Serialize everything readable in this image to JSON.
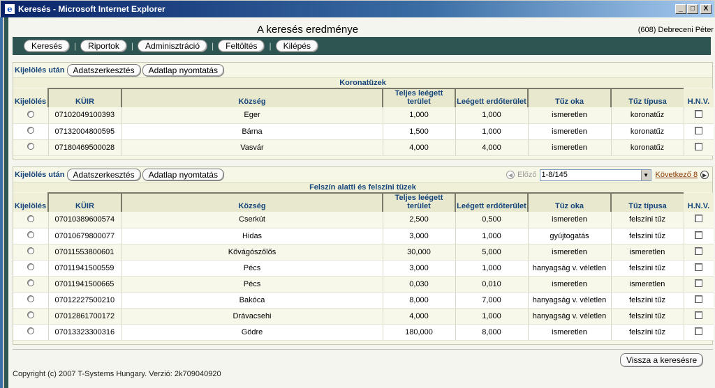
{
  "window": {
    "title": "Keresés - Microsoft Internet Explorer",
    "minimize": "_",
    "maximize": "□",
    "close": "X"
  },
  "page": {
    "title": "A keresés eredménye",
    "user": "(608) Debreceni Péter"
  },
  "nav": [
    {
      "label": "Keresés"
    },
    {
      "label": "Riportok"
    },
    {
      "label": "Adminisztráció"
    },
    {
      "label": "Feltöltés"
    },
    {
      "label": "Kilépés"
    }
  ],
  "nav_sep": "|",
  "toolbar": {
    "label": "Kijelölés után",
    "edit": "Adatszerkesztés",
    "print": "Adatlap nyomtatás"
  },
  "columns": {
    "sel": "Kijelölés",
    "kuir": "KÜIR",
    "kozseg": "Község",
    "terulet": "Teljes leégett terület",
    "erdo": "Leégett erdőterület",
    "ok": "Tűz oka",
    "tipus": "Tűz típusa",
    "hnv": "H.N.V."
  },
  "section1": {
    "title": "Koronatüzek",
    "rows": [
      {
        "kuir": "07102049100393",
        "kozseg": "Eger",
        "terulet": "1,000",
        "erdo": "1,000",
        "ok": "ismeretlen",
        "tipus": "koronatűz"
      },
      {
        "kuir": "07132004800595",
        "kozseg": "Bárna",
        "terulet": "1,500",
        "erdo": "1,000",
        "ok": "ismeretlen",
        "tipus": "koronatűz"
      },
      {
        "kuir": "07180469500028",
        "kozseg": "Vasvár",
        "terulet": "4,000",
        "erdo": "4,000",
        "ok": "ismeretlen",
        "tipus": "koronatűz"
      }
    ]
  },
  "pager": {
    "prev": "Előző",
    "range": "1-8/145",
    "next": "Következő 8"
  },
  "section2": {
    "title": "Felszín alatti és felszíni tüzek",
    "rows": [
      {
        "kuir": "07010389600574",
        "kozseg": "Cserkút",
        "terulet": "2,500",
        "erdo": "0,500",
        "ok": "ismeretlen",
        "tipus": "felszíni tűz"
      },
      {
        "kuir": "07010679800077",
        "kozseg": "Hidas",
        "terulet": "3,000",
        "erdo": "1,000",
        "ok": "gyújtogatás",
        "tipus": "felszíni tűz"
      },
      {
        "kuir": "07011553800601",
        "kozseg": "Kővágószőlős",
        "terulet": "30,000",
        "erdo": "5,000",
        "ok": "ismeretlen",
        "tipus": "ismeretlen"
      },
      {
        "kuir": "07011941500559",
        "kozseg": "Pécs",
        "terulet": "3,000",
        "erdo": "1,000",
        "ok": "hanyagság v. véletlen",
        "tipus": "felszíni tűz"
      },
      {
        "kuir": "07011941500665",
        "kozseg": "Pécs",
        "terulet": "0,030",
        "erdo": "0,010",
        "ok": "ismeretlen",
        "tipus": "ismeretlen"
      },
      {
        "kuir": "07012227500210",
        "kozseg": "Bakóca",
        "terulet": "8,000",
        "erdo": "7,000",
        "ok": "hanyagság v. véletlen",
        "tipus": "felszíni tűz"
      },
      {
        "kuir": "07012861700172",
        "kozseg": "Drávacsehi",
        "terulet": "4,000",
        "erdo": "1,000",
        "ok": "hanyagság v. véletlen",
        "tipus": "felszíni tűz"
      },
      {
        "kuir": "07013323300316",
        "kozseg": "Gödre",
        "terulet": "180,000",
        "erdo": "8,000",
        "ok": "ismeretlen",
        "tipus": "felszíni tűz"
      }
    ]
  },
  "back": "Vissza a keresésre",
  "footer": "Copyright (c) 2007 T-Systems Hungary. Verzió: 2k709040920"
}
